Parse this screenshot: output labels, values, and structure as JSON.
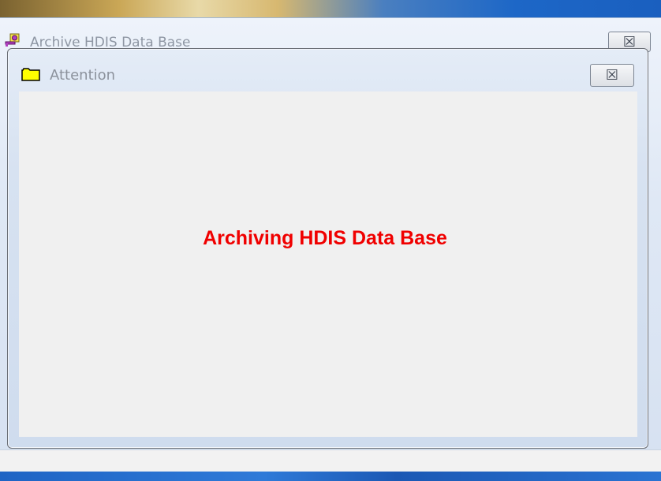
{
  "parent_window": {
    "title": "Archive HDIS Data Base",
    "icon": "key-folder-icon",
    "close_glyph": "☒"
  },
  "dialog": {
    "title": "Attention",
    "icon": "folder-icon",
    "close_glyph": "☒",
    "message": "Archiving HDIS Data Base",
    "message_color": "#f00000"
  }
}
